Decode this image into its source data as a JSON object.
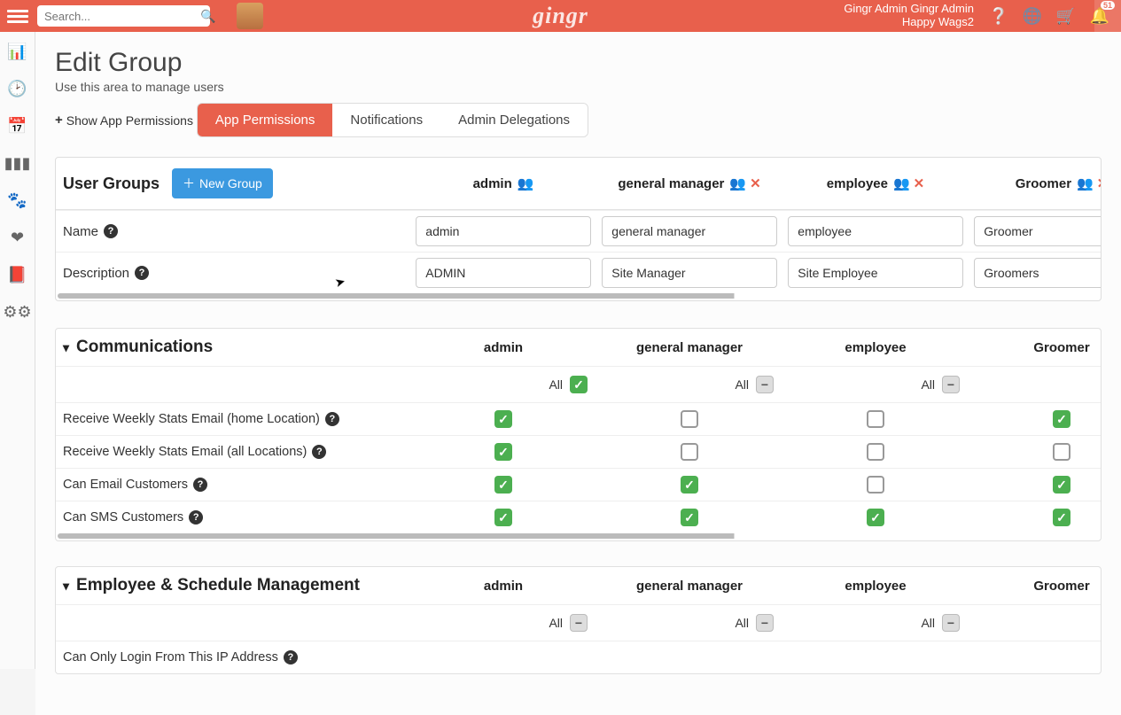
{
  "topbar": {
    "search_placeholder": "Search...",
    "logo_text": "gingr",
    "user_line1": "Gingr Admin Gingr Admin",
    "user_line2": "Happy Wags2",
    "bell_count": "51"
  },
  "page": {
    "title": "Edit Group",
    "subtitle": "Use this area to manage users",
    "show_permissions": "Show App Permissions"
  },
  "tabs": {
    "app_permissions": "App Permissions",
    "notifications": "Notifications",
    "admin_delegations": "Admin Delegations"
  },
  "user_groups_panel": {
    "title": "User Groups",
    "new_group": "New Group",
    "name_label": "Name",
    "description_label": "Description",
    "columns": [
      {
        "header": "admin",
        "removable": false,
        "name": "admin",
        "description": "ADMIN"
      },
      {
        "header": "general manager",
        "removable": true,
        "name": "general manager",
        "description": "Site Manager"
      },
      {
        "header": "employee",
        "removable": true,
        "name": "employee",
        "description": "Site Employee"
      },
      {
        "header": "Groomer",
        "removable": true,
        "name": "Groomer",
        "description": "Groomers"
      }
    ]
  },
  "all_label": "All",
  "communications": {
    "title": "Communications",
    "columns": [
      "admin",
      "general manager",
      "employee",
      "Groomer"
    ],
    "all_row": [
      "checked",
      "mixed",
      "mixed",
      "mixed"
    ],
    "rows": [
      {
        "label": "Receive Weekly Stats Email (home Location)",
        "cells": [
          "checked",
          "empty",
          "empty",
          "checked"
        ]
      },
      {
        "label": "Receive Weekly Stats Email (all Locations)",
        "cells": [
          "checked",
          "empty",
          "empty",
          "empty"
        ]
      },
      {
        "label": "Can Email Customers",
        "cells": [
          "checked",
          "checked",
          "empty",
          "checked"
        ]
      },
      {
        "label": "Can SMS Customers",
        "cells": [
          "checked",
          "checked",
          "checked",
          "checked"
        ]
      }
    ]
  },
  "employee_mgmt": {
    "title": "Employee & Schedule Management",
    "columns": [
      "admin",
      "general manager",
      "employee",
      "Groomer"
    ],
    "all_row": [
      "mixed",
      "mixed",
      "mixed",
      "mixed"
    ],
    "rows": [
      {
        "label": "Can Only Login From This IP Address",
        "cells": []
      }
    ]
  }
}
